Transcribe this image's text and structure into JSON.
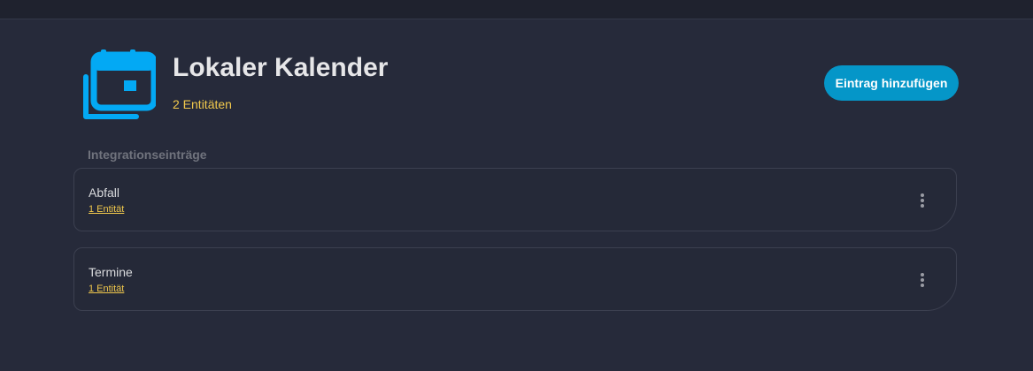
{
  "header": {
    "title": "Lokaler Kalender",
    "entity_count": "2 Entitäten",
    "add_button_label": "Eintrag hinzufügen",
    "logo_icon": "calendar-icon"
  },
  "section": {
    "label": "Integrationseinträge"
  },
  "entries": [
    {
      "name": "Abfall",
      "entities_link": "1 Entität",
      "menu_icon": "more-vertical-icon"
    },
    {
      "name": "Termine",
      "entities_link": "1 Entität",
      "menu_icon": "more-vertical-icon"
    }
  ],
  "colors": {
    "accent": "#0596c8",
    "logo": "#03a9f4",
    "link": "#f2c94c",
    "background": "#262a3a"
  }
}
